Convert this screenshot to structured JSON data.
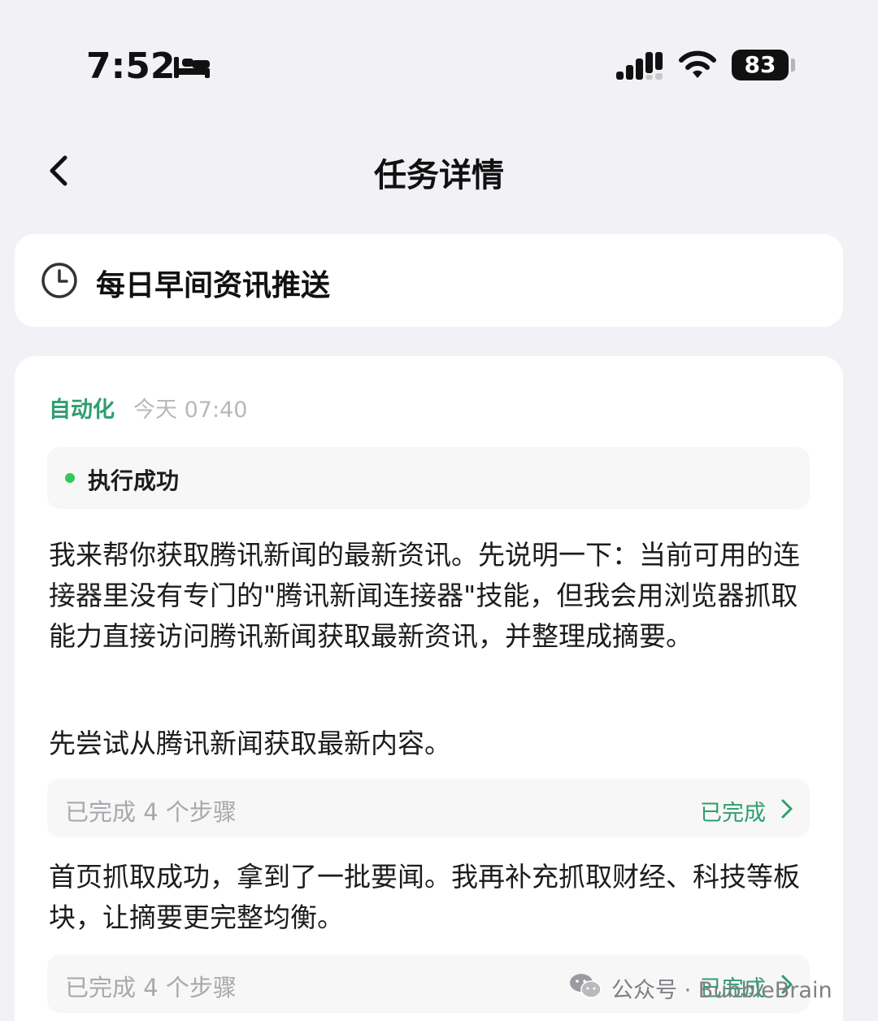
{
  "status_bar": {
    "time": "7:52",
    "battery": "83"
  },
  "nav": {
    "title": "任务详情"
  },
  "task": {
    "name": "每日早间资讯推送"
  },
  "message": {
    "tag": "自动化",
    "timestamp": "今天 07:40",
    "status": "执行成功",
    "status_color": "#34c759",
    "paragraph1": "我来帮你获取腾讯新闻的最新资讯。先说明一下：当前可用的连接器里没有专门的\"腾讯新闻连接器\"技能，但我会用浏览器抓取能力直接访问腾讯新闻获取最新资讯，并整理成摘要。",
    "paragraph2": "先尝试从腾讯新闻获取最新内容。",
    "steps1": {
      "label": "已完成 4 个步骤",
      "status": "已完成"
    },
    "paragraph3": "首页抓取成功，拿到了一批要闻。我再补充抓取财经、科技等板块，让摘要更完整均衡。",
    "steps2": {
      "label": "已完成 4 个步骤",
      "status": "已完成"
    }
  },
  "watermark": {
    "text": "公众号 · BubbleBrain"
  },
  "colors": {
    "accent_green": "#2f9e6e",
    "background": "#f2f2f6"
  }
}
